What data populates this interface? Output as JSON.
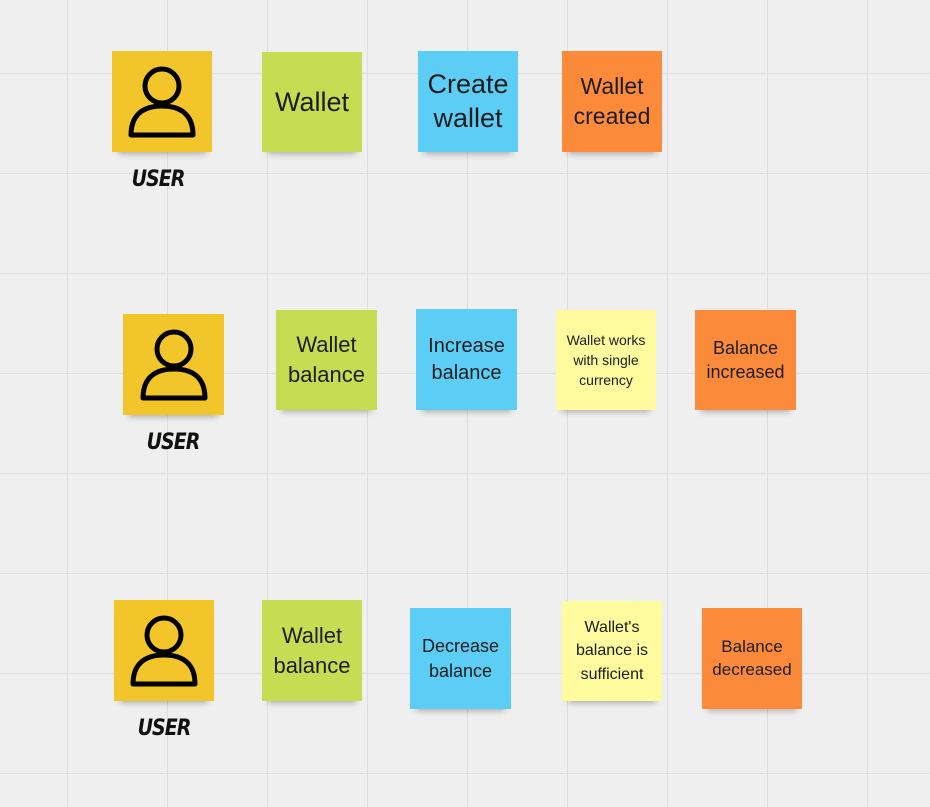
{
  "colors": {
    "actor": "#f2c52a",
    "aggregate": "#c6dc52",
    "command": "#5ccef5",
    "policy": "#fefa9e",
    "event": "#fb8b3b"
  },
  "rows": [
    {
      "user_label": "USER",
      "actor_icon": "user-icon",
      "aggregate": "Wallet",
      "command": "Create wallet",
      "event": "Wallet created"
    },
    {
      "user_label": "USER",
      "actor_icon": "user-icon",
      "aggregate": "Wallet balance",
      "command": "Increase balance",
      "policy": "Wallet works with single currency",
      "event": "Balance increased"
    },
    {
      "user_label": "USER",
      "actor_icon": "user-icon",
      "aggregate": "Wallet balance",
      "command": "Decrease balance",
      "policy": "Wallet's balance is sufficient",
      "event": "Balance decreased"
    }
  ]
}
